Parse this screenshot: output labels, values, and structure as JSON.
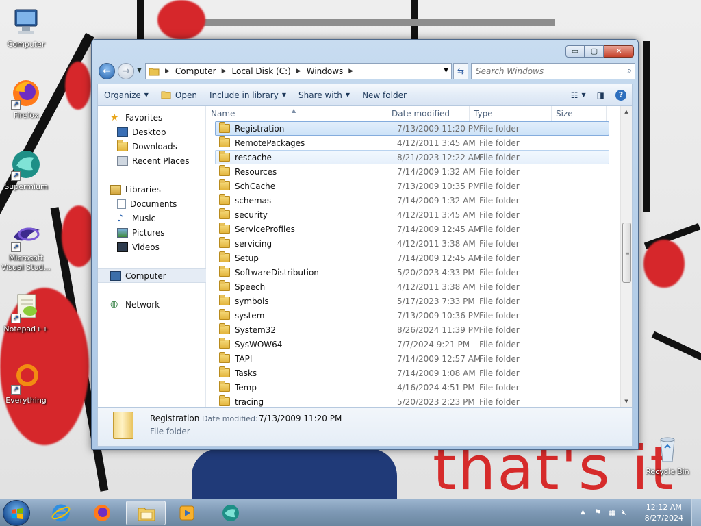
{
  "desktop": {
    "wallpaper_text": "that's it",
    "icons": [
      {
        "label": "Computer",
        "icon": "computer-icon"
      },
      {
        "label": "Firefox",
        "icon": "firefox-icon"
      },
      {
        "label": "Supermium",
        "icon": "supermium-icon"
      },
      {
        "label": "Microsoft Visual Stud...",
        "icon": "visual-studio-icon"
      },
      {
        "label": "Notepad++",
        "icon": "notepadpp-icon"
      },
      {
        "label": "Everything",
        "icon": "everything-icon"
      },
      {
        "label": "Recycle Bin",
        "icon": "recycle-bin-icon"
      }
    ]
  },
  "window": {
    "caption_buttons": {
      "minimize": "▭",
      "maximize": "▢",
      "close": "✕"
    },
    "address": {
      "segments": [
        "Computer",
        "Local Disk (C:)",
        "Windows"
      ]
    },
    "search": {
      "placeholder": "Search Windows"
    },
    "toolbar": {
      "organize": "Organize",
      "open": "Open",
      "include_in_library": "Include in library",
      "share_with": "Share with",
      "new_folder": "New folder"
    },
    "nav": {
      "favorites": "Favorites",
      "desktop": "Desktop",
      "downloads": "Downloads",
      "recent_places": "Recent Places",
      "libraries": "Libraries",
      "documents": "Documents",
      "music": "Music",
      "pictures": "Pictures",
      "videos": "Videos",
      "computer": "Computer",
      "network": "Network"
    },
    "columns": {
      "name": "Name",
      "date_modified": "Date modified",
      "type": "Type",
      "size": "Size"
    },
    "rows": [
      {
        "name": "Registration",
        "date": "7/13/2009 11:20 PM",
        "type": "File folder",
        "state": "selected"
      },
      {
        "name": "RemotePackages",
        "date": "4/12/2011 3:45 AM",
        "type": "File folder",
        "state": ""
      },
      {
        "name": "rescache",
        "date": "8/21/2023 12:22 AM",
        "type": "File folder",
        "state": "hover"
      },
      {
        "name": "Resources",
        "date": "7/14/2009 1:32 AM",
        "type": "File folder",
        "state": ""
      },
      {
        "name": "SchCache",
        "date": "7/13/2009 10:35 PM",
        "type": "File folder",
        "state": ""
      },
      {
        "name": "schemas",
        "date": "7/14/2009 1:32 AM",
        "type": "File folder",
        "state": ""
      },
      {
        "name": "security",
        "date": "4/12/2011 3:45 AM",
        "type": "File folder",
        "state": ""
      },
      {
        "name": "ServiceProfiles",
        "date": "7/14/2009 12:45 AM",
        "type": "File folder",
        "state": ""
      },
      {
        "name": "servicing",
        "date": "4/12/2011 3:38 AM",
        "type": "File folder",
        "state": ""
      },
      {
        "name": "Setup",
        "date": "7/14/2009 12:45 AM",
        "type": "File folder",
        "state": ""
      },
      {
        "name": "SoftwareDistribution",
        "date": "5/20/2023 4:33 PM",
        "type": "File folder",
        "state": ""
      },
      {
        "name": "Speech",
        "date": "4/12/2011 3:38 AM",
        "type": "File folder",
        "state": ""
      },
      {
        "name": "symbols",
        "date": "5/17/2023 7:33 PM",
        "type": "File folder",
        "state": ""
      },
      {
        "name": "system",
        "date": "7/13/2009 10:36 PM",
        "type": "File folder",
        "state": ""
      },
      {
        "name": "System32",
        "date": "8/26/2024 11:39 PM",
        "type": "File folder",
        "state": ""
      },
      {
        "name": "SysWOW64",
        "date": "7/7/2024 9:21 PM",
        "type": "File folder",
        "state": ""
      },
      {
        "name": "TAPI",
        "date": "7/14/2009 12:57 AM",
        "type": "File folder",
        "state": ""
      },
      {
        "name": "Tasks",
        "date": "7/14/2009 1:08 AM",
        "type": "File folder",
        "state": ""
      },
      {
        "name": "Temp",
        "date": "4/16/2024 4:51 PM",
        "type": "File folder",
        "state": ""
      },
      {
        "name": "tracing",
        "date": "5/20/2023 2:23 PM",
        "type": "File folder",
        "state": ""
      }
    ],
    "details": {
      "name": "Registration",
      "date_label": "Date modified:",
      "date_value": "7/13/2009 11:20 PM",
      "type": "File folder"
    }
  },
  "taskbar": {
    "items": [
      "internet-explorer-icon",
      "firefox-icon",
      "windows-explorer-icon",
      "media-player-icon",
      "supermium-icon"
    ],
    "clock": {
      "time": "12:12 AM",
      "date": "8/27/2024"
    }
  },
  "colors": {
    "accent": "#1e395b",
    "selection": "#cde3f8",
    "taskbar": "#7f9ab6"
  }
}
